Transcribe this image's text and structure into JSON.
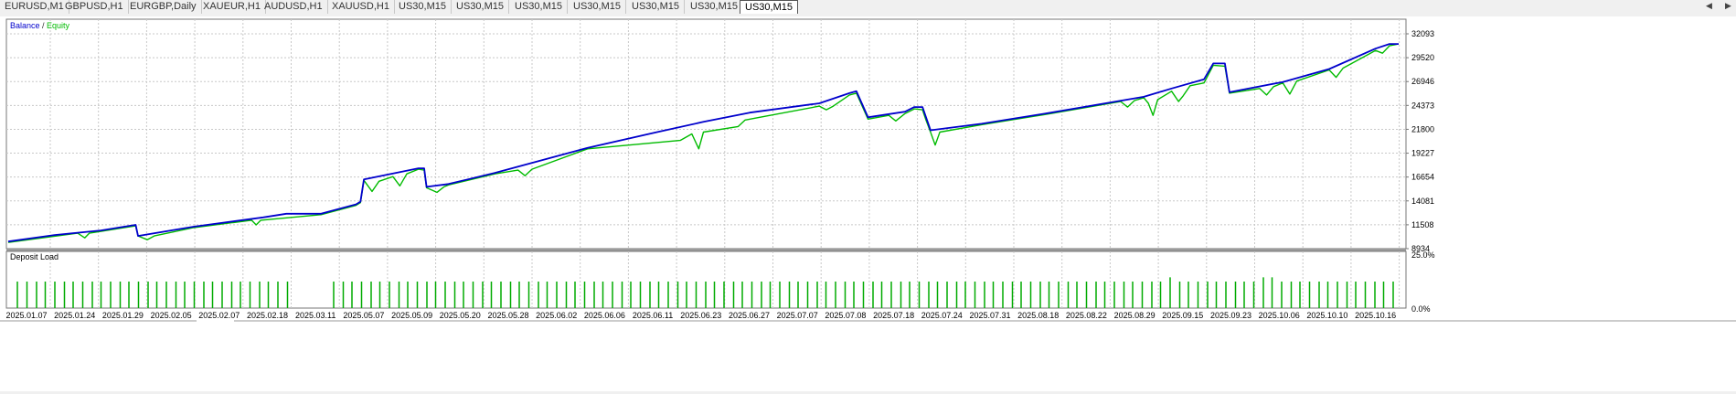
{
  "tabs": [
    {
      "label": "EURUSD,M1",
      "active": false
    },
    {
      "label": "GBPUSD,H1",
      "active": false
    },
    {
      "label": "EURGBP,Daily",
      "active": false
    },
    {
      "label": "XAUEUR,H1",
      "active": false
    },
    {
      "label": "AUDUSD,H1",
      "active": false
    },
    {
      "label": "XAUUSD,H1",
      "active": false
    },
    {
      "label": "US30,M15",
      "active": false
    },
    {
      "label": "US30,M15",
      "active": false
    },
    {
      "label": "US30,M15",
      "active": false
    },
    {
      "label": "US30,M15",
      "active": false
    },
    {
      "label": "US30,M15",
      "active": false
    },
    {
      "label": "US30,M15",
      "active": false
    },
    {
      "label": "US30,M15",
      "active": true
    }
  ],
  "icons": {
    "scroll_left": "scroll-left-icon",
    "scroll_right": "scroll-right-icon"
  },
  "colors": {
    "balance": "#0000cc",
    "equity": "#00bb00",
    "deposit_load": "#00aa00",
    "grid": "#c8c8c8"
  },
  "chart_data": [
    {
      "type": "line",
      "legend": {
        "balance_label": "Balance",
        "separator": " / ",
        "equity_label": "Equity",
        "placement": "top-left"
      },
      "y_ticks": [
        "32093",
        "29520",
        "26946",
        "24373",
        "21800",
        "19227",
        "16654",
        "14081",
        "11508",
        "8934"
      ],
      "ylim": [
        8934,
        32093
      ],
      "grid": true,
      "x_count": 29,
      "series": [
        {
          "name": "Balance",
          "points": [
            [
              0,
              9700
            ],
            [
              2,
              10400
            ],
            [
              4,
              10900
            ],
            [
              5.5,
              11500
            ],
            [
              5.6,
              10300
            ],
            [
              8,
              11300
            ],
            [
              11,
              12300
            ],
            [
              12,
              12700
            ],
            [
              13.5,
              12700
            ],
            [
              15,
              13700
            ],
            [
              15.2,
              14000
            ],
            [
              15.35,
              16400
            ],
            [
              17.7,
              17600
            ],
            [
              17.95,
              17600
            ],
            [
              18.05,
              15600
            ],
            [
              19,
              15900
            ],
            [
              21,
              17100
            ],
            [
              25,
              19800
            ],
            [
              28,
              21500
            ],
            [
              30,
              22600
            ],
            [
              32,
              23600
            ],
            [
              35,
              24600
            ],
            [
              36.3,
              25700
            ],
            [
              36.6,
              25900
            ],
            [
              37.1,
              23100
            ],
            [
              38.7,
              23700
            ],
            [
              39.1,
              24200
            ],
            [
              39.45,
              24200
            ],
            [
              39.8,
              21700
            ],
            [
              42,
              22400
            ],
            [
              45,
              23600
            ],
            [
              49,
              25300
            ],
            [
              50.2,
              26200
            ],
            [
              51.6,
              27200
            ],
            [
              52,
              28900
            ],
            [
              52.5,
              28900
            ],
            [
              52.7,
              25800
            ],
            [
              55,
              26900
            ],
            [
              57,
              28300
            ],
            [
              59,
              30500
            ],
            [
              59.6,
              31000
            ],
            [
              60,
              31000
            ]
          ]
        },
        {
          "name": "Equity",
          "points": [
            [
              0,
              9600
            ],
            [
              3,
              10600
            ],
            [
              3.3,
              10100
            ],
            [
              3.5,
              10600
            ],
            [
              5.5,
              11400
            ],
            [
              5.6,
              10300
            ],
            [
              6,
              9900
            ],
            [
              6.3,
              10300
            ],
            [
              8,
              11200
            ],
            [
              10.5,
              12000
            ],
            [
              10.7,
              11500
            ],
            [
              10.9,
              12000
            ],
            [
              13.5,
              12600
            ],
            [
              15,
              13600
            ],
            [
              15.2,
              13900
            ],
            [
              15.35,
              16300
            ],
            [
              15.7,
              15100
            ],
            [
              16,
              16200
            ],
            [
              16.6,
              16700
            ],
            [
              16.9,
              15700
            ],
            [
              17.2,
              17000
            ],
            [
              17.7,
              17500
            ],
            [
              17.95,
              17400
            ],
            [
              18.05,
              15500
            ],
            [
              18.5,
              15000
            ],
            [
              18.8,
              15600
            ],
            [
              19,
              15800
            ],
            [
              21,
              17000
            ],
            [
              22,
              17400
            ],
            [
              22.3,
              16800
            ],
            [
              22.6,
              17500
            ],
            [
              25,
              19700
            ],
            [
              29,
              20600
            ],
            [
              29.5,
              21300
            ],
            [
              29.8,
              19700
            ],
            [
              30,
              21500
            ],
            [
              31.5,
              22100
            ],
            [
              31.8,
              22800
            ],
            [
              35,
              24300
            ],
            [
              35.3,
              23900
            ],
            [
              35.6,
              24300
            ],
            [
              36.3,
              25500
            ],
            [
              36.6,
              25700
            ],
            [
              37.1,
              22900
            ],
            [
              38,
              23300
            ],
            [
              38.3,
              22700
            ],
            [
              38.7,
              23500
            ],
            [
              39.1,
              24000
            ],
            [
              39.45,
              23900
            ],
            [
              39.6,
              22800
            ],
            [
              39.8,
              21500
            ],
            [
              40,
              20100
            ],
            [
              40.2,
              21500
            ],
            [
              42,
              22300
            ],
            [
              45,
              23500
            ],
            [
              48,
              24800
            ],
            [
              48.3,
              24200
            ],
            [
              48.6,
              24900
            ],
            [
              49,
              25200
            ],
            [
              49.2,
              24600
            ],
            [
              49.4,
              23300
            ],
            [
              49.6,
              25000
            ],
            [
              50.2,
              25900
            ],
            [
              50.5,
              24800
            ],
            [
              50.7,
              25400
            ],
            [
              51,
              26500
            ],
            [
              51.6,
              26800
            ],
            [
              52,
              28700
            ],
            [
              52.5,
              28600
            ],
            [
              52.7,
              25700
            ],
            [
              54,
              26200
            ],
            [
              54.3,
              25500
            ],
            [
              54.6,
              26400
            ],
            [
              55,
              26800
            ],
            [
              55.3,
              25600
            ],
            [
              55.6,
              27000
            ],
            [
              57,
              28200
            ],
            [
              57.3,
              27400
            ],
            [
              57.6,
              28400
            ],
            [
              59,
              30300
            ],
            [
              59.3,
              30000
            ],
            [
              59.6,
              30800
            ],
            [
              60,
              31000
            ]
          ]
        }
      ]
    },
    {
      "type": "bar",
      "title": "Deposit Load",
      "y_ticks": [
        "25.0%",
        "0.0%"
      ],
      "x_tick_labels": [
        "2025.01.07",
        "2025.01.24",
        "2025.01.29",
        "2025.02.05",
        "2025.02.07",
        "2025.02.18",
        "2025.03.11",
        "2025.05.07",
        "2025.05.09",
        "2025.05.20",
        "2025.05.28",
        "2025.06.02",
        "2025.06.06",
        "2025.06.11",
        "2025.06.23",
        "2025.06.27",
        "2025.07.07",
        "2025.07.08",
        "2025.07.18",
        "2025.07.24",
        "2025.07.31",
        "2025.08.18",
        "2025.08.22",
        "2025.08.29",
        "2025.09.15",
        "2025.09.23",
        "2025.10.06",
        "2025.10.10",
        "2025.10.16"
      ],
      "typical_value_pct": 12.5,
      "peak_value_pct": 14.5
    }
  ]
}
